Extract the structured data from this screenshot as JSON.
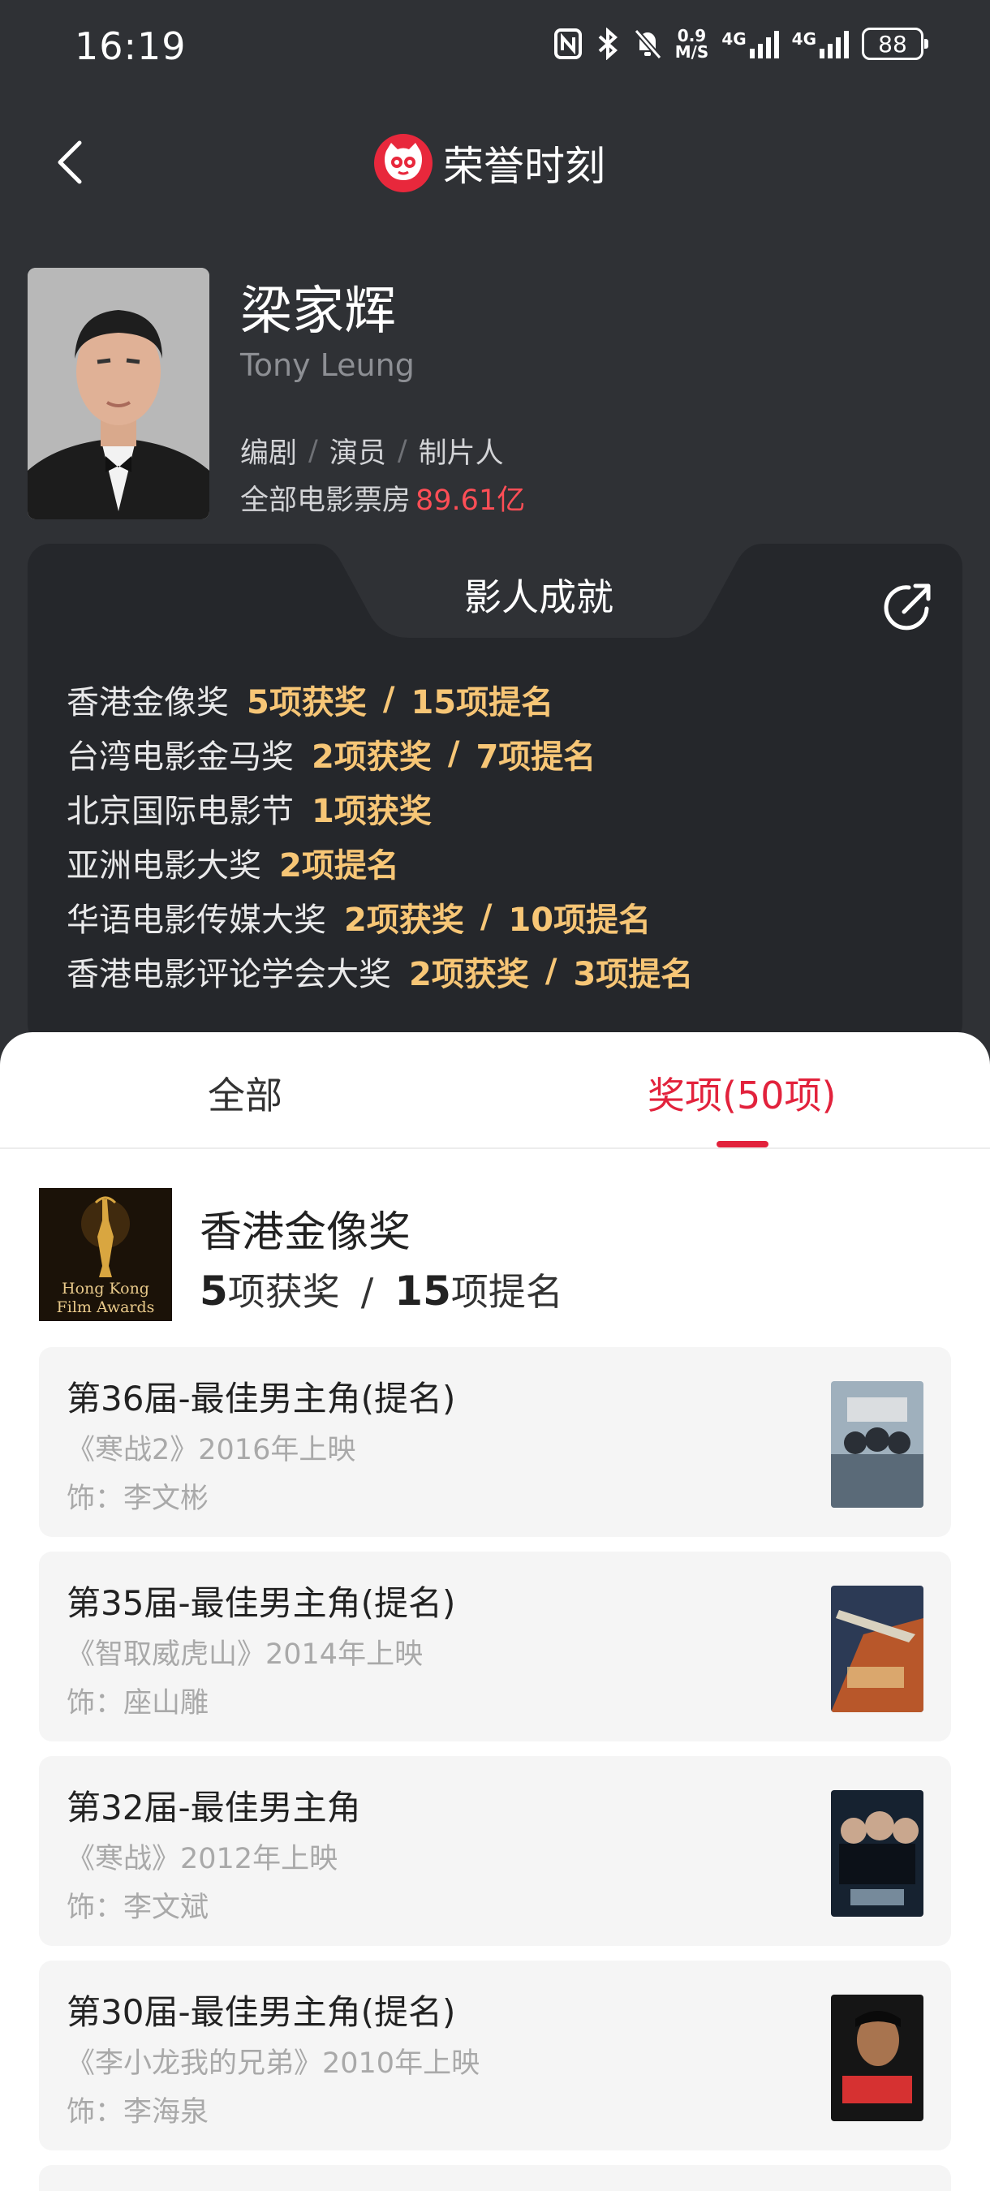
{
  "status_bar": {
    "time": "16:19",
    "net_speed_top": "0.9",
    "net_speed_bottom": "M/S",
    "signal1_label": "4G",
    "signal2_label": "4G",
    "battery": "88"
  },
  "header": {
    "title": "荣誉时刻"
  },
  "profile": {
    "name": "梁家辉",
    "english_name": "Tony Leung",
    "roles": [
      "编剧",
      "演员",
      "制片人"
    ],
    "role_separator": "/",
    "box_office_label": "全部电影票房",
    "box_office_value": "89.61亿"
  },
  "achievements": {
    "title": "影人成就",
    "separator": "/",
    "items": [
      {
        "name": "香港金像奖",
        "wins": "5项获奖",
        "noms": "15项提名"
      },
      {
        "name": "台湾电影金马奖",
        "wins": "2项获奖",
        "noms": "7项提名"
      },
      {
        "name": "北京国际电影节",
        "wins": "1项获奖",
        "noms": ""
      },
      {
        "name": "亚洲电影大奖",
        "wins": "",
        "noms": "2项提名"
      },
      {
        "name": "华语电影传媒大奖",
        "wins": "2项获奖",
        "noms": "10项提名"
      },
      {
        "name": "香港电影评论学会大奖",
        "wins": "2项获奖",
        "noms": "3项提名"
      }
    ]
  },
  "tabs": {
    "all": "全部",
    "awards": "奖项(50项)"
  },
  "award_section": {
    "name": "香港金像奖",
    "logo_text_1": "Hong Kong",
    "logo_text_2": "Film Awards",
    "wins_num": "5",
    "wins_label": "项获奖",
    "separator": "/",
    "noms_num": "15",
    "noms_label": "项提名"
  },
  "entries": [
    {
      "title": "第36届-最佳男主角(提名)",
      "movie": "《寒战2》2016年上映",
      "role": "饰：李文彬",
      "poster_color": "#8a9aa8"
    },
    {
      "title": "第35届-最佳男主角(提名)",
      "movie": "《智取威虎山》2014年上映",
      "role": "饰：座山雕",
      "poster_color": "#3a4a66"
    },
    {
      "title": "第32届-最佳男主角",
      "movie": "《寒战》2012年上映",
      "role": "饰：李文斌",
      "poster_color": "#1f2a36"
    },
    {
      "title": "第30届-最佳男主角(提名)",
      "movie": "《李小龙我的兄弟》2010年上映",
      "role": "饰：李海泉",
      "poster_color": "#1a1a1a"
    }
  ]
}
